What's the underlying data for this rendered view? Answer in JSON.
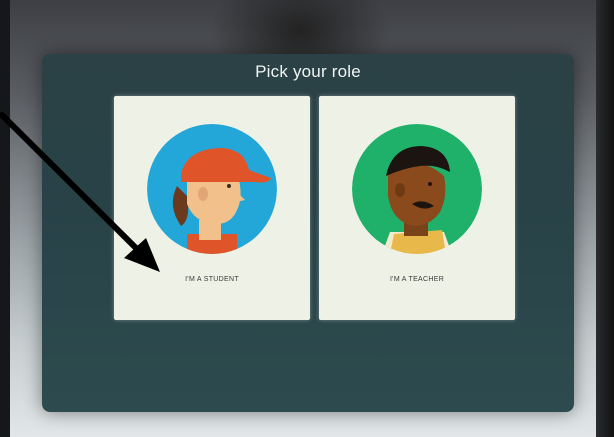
{
  "dialog": {
    "title": "Pick your role"
  },
  "roles": [
    {
      "label": "I'M A STUDENT",
      "icon": "student-avatar-icon",
      "circle_color": "#22a7d8"
    },
    {
      "label": "I'M A TEACHER",
      "icon": "teacher-avatar-icon",
      "circle_color": "#1fb06a"
    }
  ],
  "colors": {
    "modal_bg": "#2b4146",
    "card_bg": "#eef1e6"
  }
}
